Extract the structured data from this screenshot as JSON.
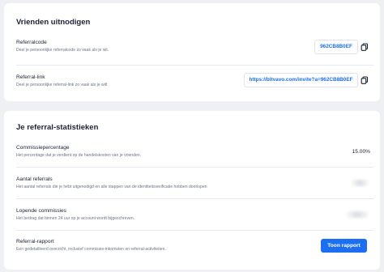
{
  "invite": {
    "title": "Vrienden uitnodigen",
    "referral_code": {
      "label": "Referralcode",
      "description": "Deel je persoonlijke referralcode zo vaak als je wil.",
      "value": "962CB8B0EF"
    },
    "referral_link": {
      "label": "Referral-link",
      "description": "Deel je persoonlijke referral-link zo vaak als je wilt",
      "value": "https://bitvavo.com/invite?a=962CB8B0EF"
    },
    "copy_icon": "copy-icon"
  },
  "stats": {
    "title": "Je referral-statistieken",
    "commission": {
      "label": "Commissiepercentage",
      "description": "Het percentage dat je verdient op de handelskosten van je vrienden.",
      "value": "15.00%"
    },
    "referral_count": {
      "label": "Aantal referrals",
      "description": "Het aantal referrals die je hebt uitgenodigd en alle stappen van de identiteitsverificatie hebben doorlopen"
    },
    "pending": {
      "label": "Lopende commissies",
      "description": "Het bedrag dat binnen 24 uur op je account wordt bijgeschreven."
    },
    "report": {
      "label": "Referral-rapport",
      "description": "Een gedetailleerd overzicht, inclusief commissie-inkomsten en referral-activiteiten.",
      "button_label": "Toon rapport"
    }
  },
  "colors": {
    "accent": "#1b6ff0",
    "background": "#eef0f4",
    "card": "#ffffff"
  }
}
